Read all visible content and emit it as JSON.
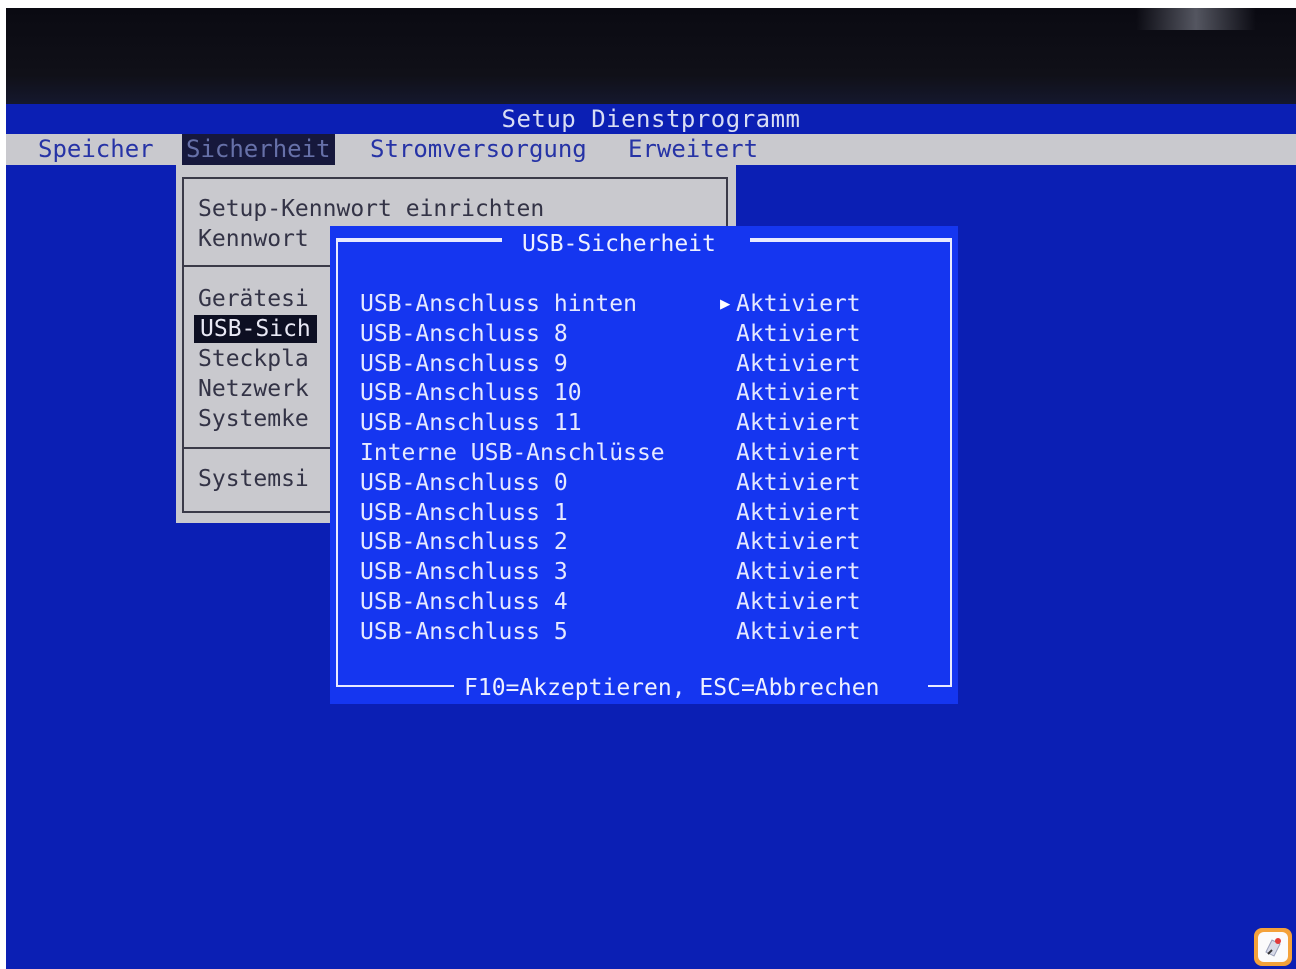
{
  "header": {
    "title": "Setup Dienstprogramm"
  },
  "menubar": {
    "items": [
      {
        "label": "Speicher",
        "active": false
      },
      {
        "label": "Sicherheit",
        "active": true
      },
      {
        "label": "Stromversorgung",
        "active": false
      },
      {
        "label": "Erweitert",
        "active": false
      }
    ]
  },
  "submenu": {
    "items": [
      "Setup-Kennwort einrichten",
      "Kennwort",
      "Gerätesi",
      "USB-Sich",
      "Steckpla",
      "Netzwerk",
      "Systemke",
      "Systemsi"
    ],
    "selected_index": 3
  },
  "dialog": {
    "title": "USB-Sicherheit",
    "footer": "F10=Akzeptieren, ESC=Abbrechen",
    "cursor_glyph": "▶",
    "rows": [
      {
        "label": "USB-Anschluss hinten",
        "value": "Aktiviert"
      },
      {
        "label": "USB-Anschluss 8",
        "value": "Aktiviert"
      },
      {
        "label": "USB-Anschluss 9",
        "value": "Aktiviert"
      },
      {
        "label": "USB-Anschluss 10",
        "value": "Aktiviert"
      },
      {
        "label": "USB-Anschluss 11",
        "value": "Aktiviert"
      },
      {
        "label": "Interne USB-Anschlüsse",
        "value": "Aktiviert"
      },
      {
        "label": "USB-Anschluss 0",
        "value": "Aktiviert"
      },
      {
        "label": "USB-Anschluss 1",
        "value": "Aktiviert"
      },
      {
        "label": "USB-Anschluss 2",
        "value": "Aktiviert"
      },
      {
        "label": "USB-Anschluss 3",
        "value": "Aktiviert"
      },
      {
        "label": "USB-Anschluss 4",
        "value": "Aktiviert"
      },
      {
        "label": "USB-Anschluss 5",
        "value": "Aktiviert"
      }
    ],
    "focused_row": 0
  },
  "colors": {
    "screen_bg": "#0b1fb4",
    "dialog_bg": "#1536f0",
    "menubar_bg": "#c9c9ce",
    "menu_text": "#2633a6",
    "frame": "#e8eaff"
  },
  "icons": {
    "corner_badge": "app-badge-icon"
  }
}
